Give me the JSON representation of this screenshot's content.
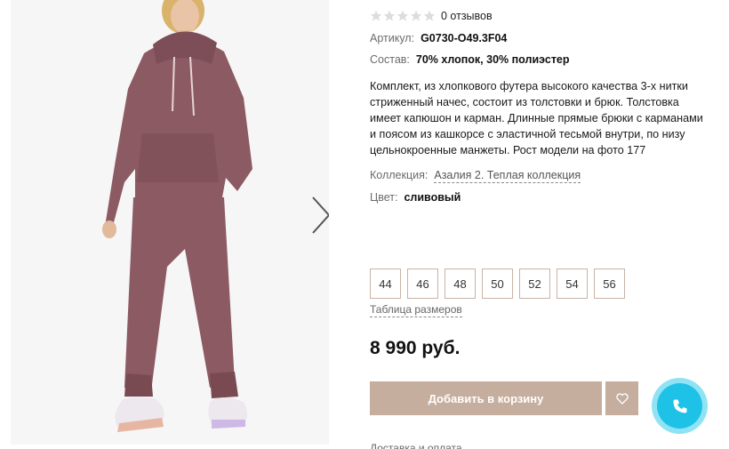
{
  "product": {
    "reviews": "0 отзывов",
    "article_label": "Артикул:",
    "article_value": "G0730-O49.3F04",
    "composition_label": "Состав:",
    "composition_value": "70% хлопок, 30% полиэстер",
    "description": "Комплект, из хлопкового футера высокого качества 3-х нитки стриженный начес, состоит из толстовки и брюк. Толстовка имеет капюшон и карман. Длинные прямые брюки с карманами и поясом из кашкорсе с эластичной тесьмой внутри, по низу цельнокроенные манжеты. Рост модели на фото 177",
    "collection_label": "Коллекция:",
    "collection_value": "Азалия 2. Теплая коллекция",
    "color_label": "Цвет:",
    "color_value": "сливовый",
    "sizes": [
      "44",
      "46",
      "48",
      "50",
      "52",
      "54",
      "56"
    ],
    "size_table": "Таблица размеров",
    "price": "8 990 руб.",
    "add_to_cart": "Добавить в корзину",
    "delivery": "Доставка и оплата"
  },
  "icons": {
    "star": "star-icon",
    "next": "chevron-right-icon",
    "wishlist": "heart-icon",
    "call": "phone-icon"
  },
  "colors": {
    "accent": "#c6ae9f",
    "size_border": "#c7b3a6",
    "call_outer": "#8fe3f4",
    "call_inner": "#1ec2e6",
    "suit": "#8c5a63"
  }
}
